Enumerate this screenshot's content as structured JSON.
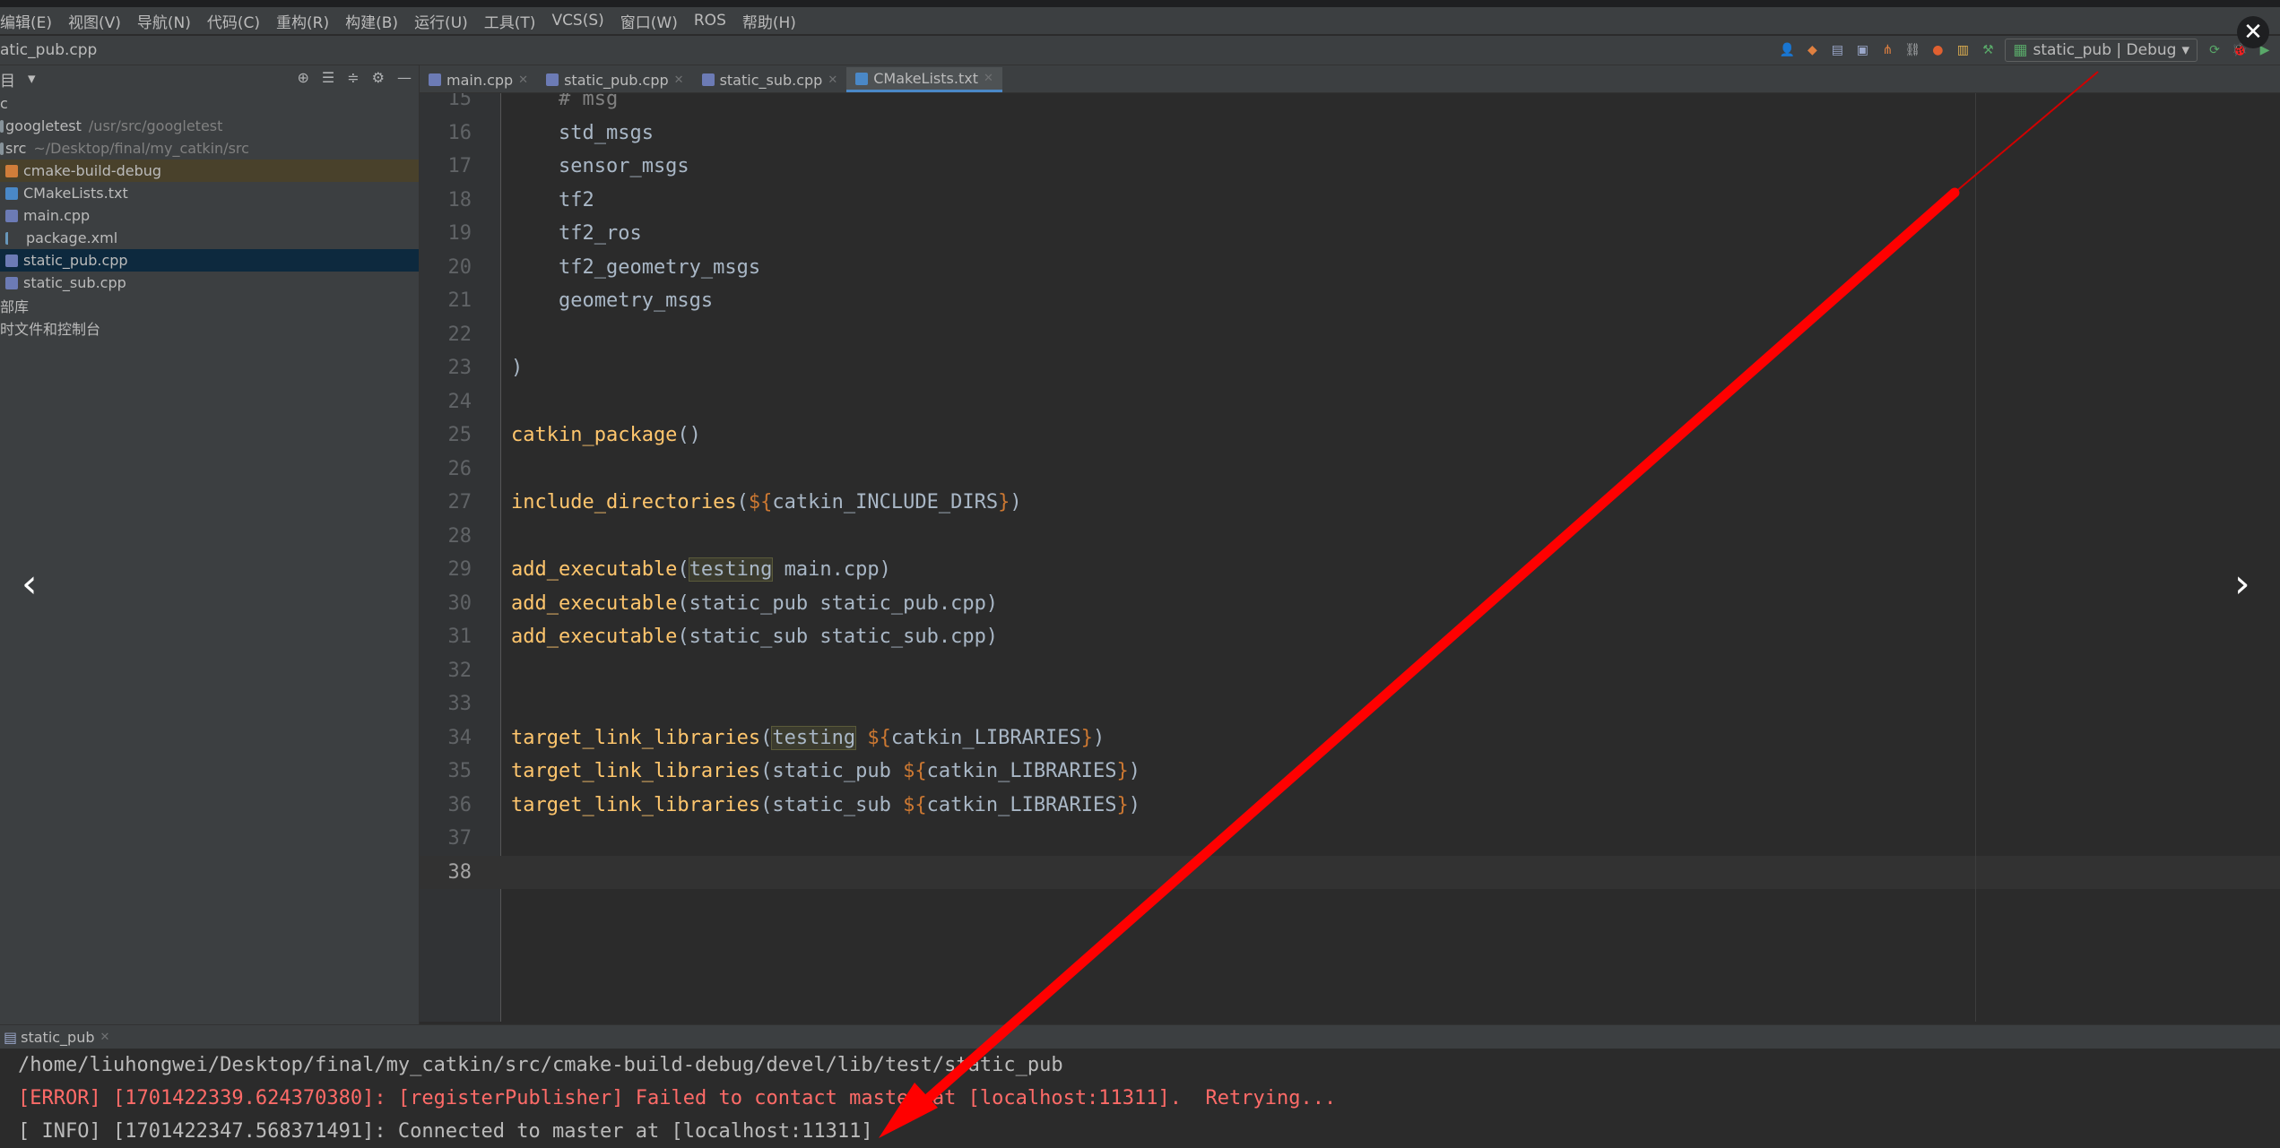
{
  "menu": [
    "编辑(E)",
    "视图(V)",
    "导航(N)",
    "代码(C)",
    "重构(R)",
    "构建(B)",
    "运行(U)",
    "工具(T)",
    "VCS(S)",
    "窗口(W)",
    "ROS",
    "帮助(H)"
  ],
  "breadcrumb": "atic_pub.cpp",
  "run_config": {
    "label": "static_pub | Debug"
  },
  "sidebar": {
    "title": "目",
    "items": [
      {
        "label": "c",
        "muted": ""
      },
      {
        "label": "googletest",
        "muted": "/usr/src/googletest"
      },
      {
        "label": "src",
        "muted": "~/Desktop/final/my_catkin/src"
      },
      {
        "label": "cmake-build-debug",
        "muted": ""
      },
      {
        "label": "CMakeLists.txt",
        "muted": ""
      },
      {
        "label": "main.cpp",
        "muted": ""
      },
      {
        "label": "package.xml",
        "muted": ""
      },
      {
        "label": "static_pub.cpp",
        "muted": ""
      },
      {
        "label": "static_sub.cpp",
        "muted": ""
      },
      {
        "label": "部库",
        "muted": ""
      },
      {
        "label": "时文件和控制台",
        "muted": ""
      }
    ]
  },
  "tabs": [
    "main.cpp",
    "static_pub.cpp",
    "static_sub.cpp",
    "CMakeLists.txt"
  ],
  "editor": {
    "lines": [
      {
        "n": "15",
        "code": "    # msg"
      },
      {
        "n": "16",
        "code": "    std_msgs"
      },
      {
        "n": "17",
        "code": "    sensor_msgs"
      },
      {
        "n": "18",
        "code": "    tf2"
      },
      {
        "n": "19",
        "code": "    tf2_ros"
      },
      {
        "n": "20",
        "code": "    tf2_geometry_msgs"
      },
      {
        "n": "21",
        "code": "    geometry_msgs"
      },
      {
        "n": "22",
        "code": ""
      },
      {
        "n": "23",
        "code": ")"
      },
      {
        "n": "24",
        "code": ""
      },
      {
        "n": "25",
        "fn": "catkin_package",
        "code": "()"
      },
      {
        "n": "26",
        "code": ""
      },
      {
        "n": "27",
        "fn": "include_directories",
        "code": "(${catkin_INCLUDE_DIRS})"
      },
      {
        "n": "28",
        "code": ""
      },
      {
        "n": "29",
        "fn": "add_executable",
        "code": "(testing main.cpp)"
      },
      {
        "n": "30",
        "fn": "add_executable",
        "code": "(static_pub static_pub.cpp)"
      },
      {
        "n": "31",
        "fn": "add_executable",
        "code": "(static_sub static_sub.cpp)"
      },
      {
        "n": "32",
        "code": ""
      },
      {
        "n": "33",
        "code": ""
      },
      {
        "n": "34",
        "fn": "target_link_libraries",
        "code": "(testing ${catkin_LIBRARIES})"
      },
      {
        "n": "35",
        "fn": "target_link_libraries",
        "code": "(static_pub ${catkin_LIBRARIES})"
      },
      {
        "n": "36",
        "fn": "target_link_libraries",
        "code": "(static_sub ${catkin_LIBRARIES})"
      },
      {
        "n": "37",
        "code": ""
      },
      {
        "n": "38",
        "code": ""
      }
    ]
  },
  "run_tab": "static_pub",
  "console": [
    {
      "type": "path",
      "text": "/home/liuhongwei/Desktop/final/my_catkin/src/cmake-build-debug/devel/lib/test/static_pub"
    },
    {
      "type": "err",
      "text": "[ERROR] [1701422339.624370380]: [registerPublisher] Failed to contact master at [localhost:11311].  Retrying..."
    },
    {
      "type": "info",
      "text": "[ INFO] [1701422347.568371491]: Connected to master at [localhost:11311]"
    }
  ],
  "overlay": {
    "prev": "‹",
    "next": "›",
    "close": "✕"
  },
  "colors": {
    "annotation_arrow": "#ff0000"
  }
}
